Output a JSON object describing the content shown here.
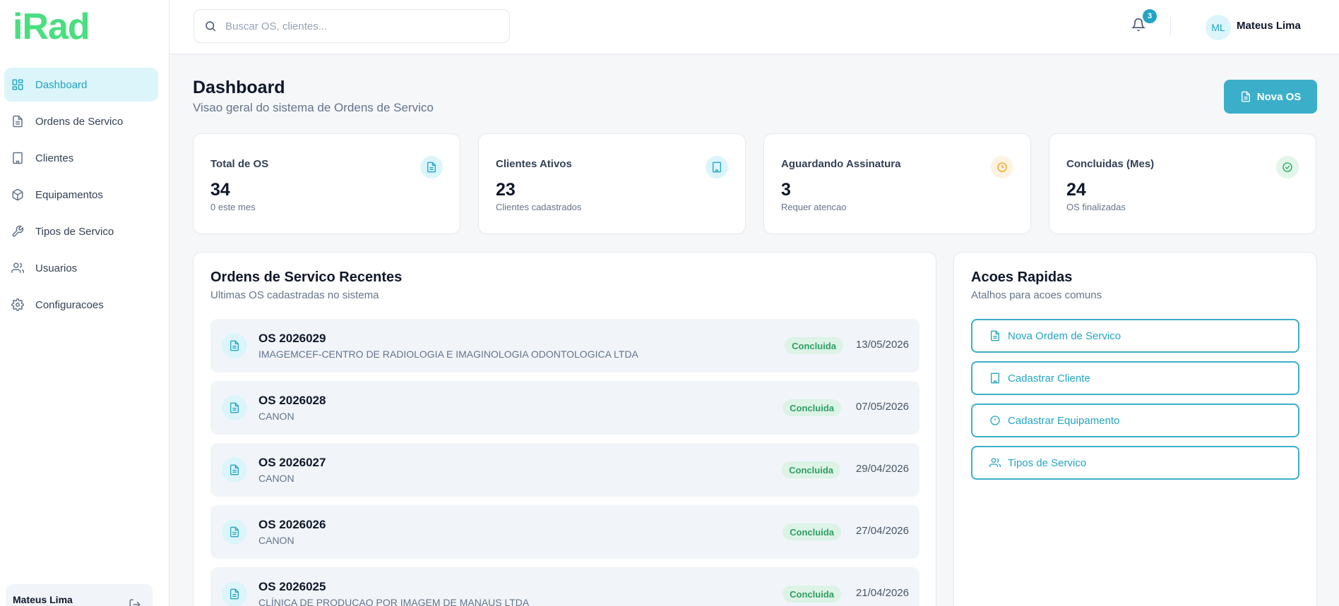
{
  "app": {
    "logo": "iRad"
  },
  "sidebar": {
    "items": [
      {
        "label": "Dashboard",
        "icon": "dashboard-icon",
        "active": true
      },
      {
        "label": "Ordens de Servico",
        "icon": "document-icon"
      },
      {
        "label": "Clientes",
        "icon": "building-icon"
      },
      {
        "label": "Equipamentos",
        "icon": "box-icon"
      },
      {
        "label": "Tipos de Servico",
        "icon": "wrench-icon"
      },
      {
        "label": "Usuarios",
        "icon": "users-icon"
      },
      {
        "label": "Configuracoes",
        "icon": "gear-icon"
      }
    ],
    "user_name": "Mateus Lima"
  },
  "topbar": {
    "search_placeholder": "Buscar OS, clientes...",
    "notifications_count": "3",
    "user_initials": "ML",
    "user_name": "Mateus Lima"
  },
  "header": {
    "title": "Dashboard",
    "subtitle": "Visao geral do sistema de Ordens de Servico",
    "new_button": "Nova OS"
  },
  "stats": [
    {
      "label": "Total de OS",
      "value": "34",
      "sub": "0 este mes",
      "icon": "document-icon",
      "color": "#22a5c3"
    },
    {
      "label": "Clientes Ativos",
      "value": "23",
      "sub": "Clientes cadastrados",
      "icon": "building-icon",
      "color": "#22a5c3"
    },
    {
      "label": "Aguardando Assinatura",
      "value": "3",
      "sub": "Requer atencao",
      "icon": "clock-icon",
      "color": "#f59e0b"
    },
    {
      "label": "Concluidas (Mes)",
      "value": "24",
      "sub": "OS finalizadas",
      "icon": "check-circle-icon",
      "color": "#22a55e"
    }
  ],
  "recent": {
    "title": "Ordens de Servico Recentes",
    "subtitle": "Ultimas OS cadastradas no sistema",
    "rows": [
      {
        "number": "OS 2026029",
        "client": "IMAGEMCEF-CENTRO DE RADIOLOGIA E IMAGINOLOGIA ODONTOLOGICA LTDA",
        "status": "Concluida",
        "date": "13/05/2026"
      },
      {
        "number": "OS 2026028",
        "client": "CANON",
        "status": "Concluida",
        "date": "07/05/2026"
      },
      {
        "number": "OS 2026027",
        "client": "CANON",
        "status": "Concluida",
        "date": "29/04/2026"
      },
      {
        "number": "OS 2026026",
        "client": "CANON",
        "status": "Concluida",
        "date": "27/04/2026"
      },
      {
        "number": "OS 2026025",
        "client": "CLÍNICA DE PRODUCAO POR IMAGEM DE MANAUS LTDA",
        "status": "Concluida",
        "date": "21/04/2026"
      }
    ]
  },
  "quick_actions": {
    "title": "Acoes Rapidas",
    "subtitle": "Atalhos para acoes comuns",
    "items": [
      {
        "label": "Nova Ordem de Servico",
        "icon": "document-icon"
      },
      {
        "label": "Cadastrar Cliente",
        "icon": "building-icon"
      },
      {
        "label": "Cadastrar Equipamento",
        "icon": "alert-circle-icon"
      },
      {
        "label": "Tipos de Servico",
        "icon": "users-icon"
      }
    ]
  },
  "colors": {
    "accent": "#22a5c3",
    "button": "#3bafca",
    "logo": "#4ade80",
    "success_bg": "#dcf3e6",
    "success_text": "#2e9e63"
  }
}
